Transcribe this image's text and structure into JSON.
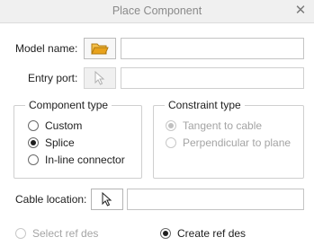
{
  "window": {
    "title": "Place Component"
  },
  "model": {
    "label": "Model name:",
    "icon": "folder-open-icon",
    "value": ""
  },
  "entry": {
    "label": "Entry port:",
    "icon": "pointer-arrow-icon",
    "value": ""
  },
  "component_type": {
    "title": "Component type",
    "options": [
      {
        "label": "Custom",
        "selected": false
      },
      {
        "label": "Splice",
        "selected": true
      },
      {
        "label": "In-line connector",
        "selected": false
      }
    ]
  },
  "constraint_type": {
    "title": "Constraint type",
    "options": [
      {
        "label": "Tangent to cable",
        "selected": true
      },
      {
        "label": "Perpendicular to plane",
        "selected": false
      }
    ]
  },
  "cable": {
    "label": "Cable location:",
    "icon": "pointer-arrow-icon",
    "value": ""
  },
  "ref_des": {
    "select": {
      "label": "Select ref des",
      "selected": false
    },
    "create": {
      "label": "Create ref des",
      "selected": true
    }
  },
  "colors": {
    "folder": "#e8a21c",
    "disabled_text": "#a4a4a4"
  }
}
